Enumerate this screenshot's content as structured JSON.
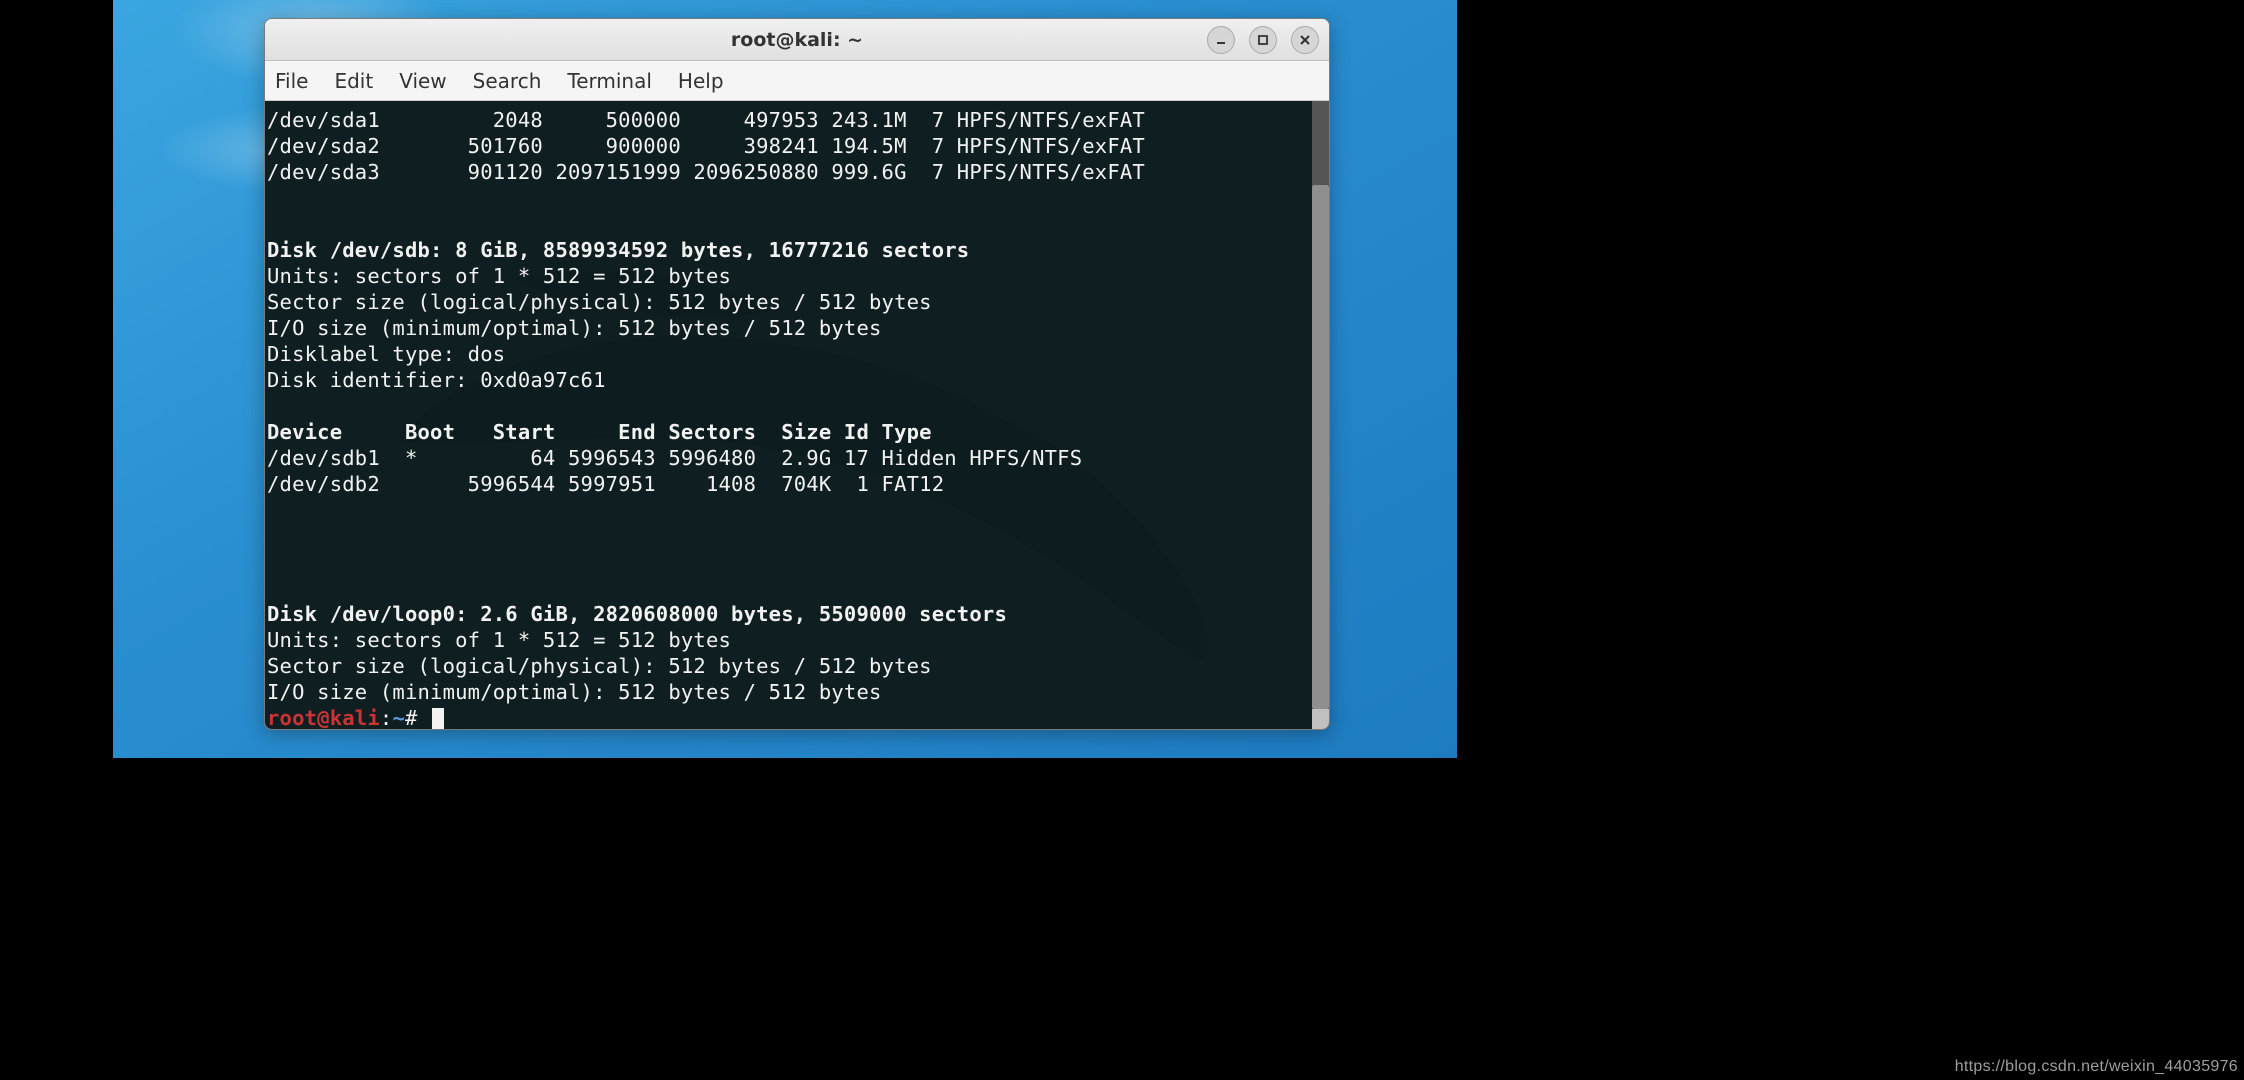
{
  "window": {
    "title": "root@kali: ~"
  },
  "menubar": {
    "items": [
      "File",
      "Edit",
      "View",
      "Search",
      "Terminal",
      "Help"
    ]
  },
  "terminal": {
    "sda_partitions": [
      {
        "device": "/dev/sda1",
        "start": "2048",
        "end": "500000",
        "sectors": "497953",
        "size": "243.1M",
        "id": "7",
        "type": "HPFS/NTFS/exFAT"
      },
      {
        "device": "/dev/sda2",
        "start": "501760",
        "end": "900000",
        "sectors": "398241",
        "size": "194.5M",
        "id": "7",
        "type": "HPFS/NTFS/exFAT"
      },
      {
        "device": "/dev/sda3",
        "start": "901120",
        "end": "2097151999",
        "sectors": "2096250880",
        "size": "999.6G",
        "id": "7",
        "type": "HPFS/NTFS/exFAT"
      }
    ],
    "sdb_header": "Disk /dev/sdb: 8 GiB, 8589934592 bytes, 16777216 sectors",
    "sdb_units": "Units: sectors of 1 * 512 = 512 bytes",
    "sdb_sector": "Sector size (logical/physical): 512 bytes / 512 bytes",
    "sdb_io": "I/O size (minimum/optimal): 512 bytes / 512 bytes",
    "sdb_label": "Disklabel type: dos",
    "sdb_id": "Disk identifier: 0xd0a97c61",
    "sdb_cols": "Device     Boot   Start     End Sectors  Size Id Type",
    "sdb_partitions": [
      {
        "device": "/dev/sdb1",
        "boot": "*",
        "start": "64",
        "end": "5996543",
        "sectors": "5996480",
        "size": "2.9G",
        "id": "17",
        "type": "Hidden HPFS/NTFS"
      },
      {
        "device": "/dev/sdb2",
        "boot": " ",
        "start": "5996544",
        "end": "5997951",
        "sectors": "1408",
        "size": "704K",
        "id": "1",
        "type": "FAT12"
      }
    ],
    "loop_header": "Disk /dev/loop0: 2.6 GiB, 2820608000 bytes, 5509000 sectors",
    "loop_units": "Units: sectors of 1 * 512 = 512 bytes",
    "loop_sector": "Sector size (logical/physical): 512 bytes / 512 bytes",
    "loop_io": "I/O size (minimum/optimal): 512 bytes / 512 bytes",
    "prompt_user": "root@kali",
    "prompt_sep": ":",
    "prompt_path": "~",
    "prompt_hash": "# "
  },
  "watermark": "https://blog.csdn.net/weixin_44035976"
}
